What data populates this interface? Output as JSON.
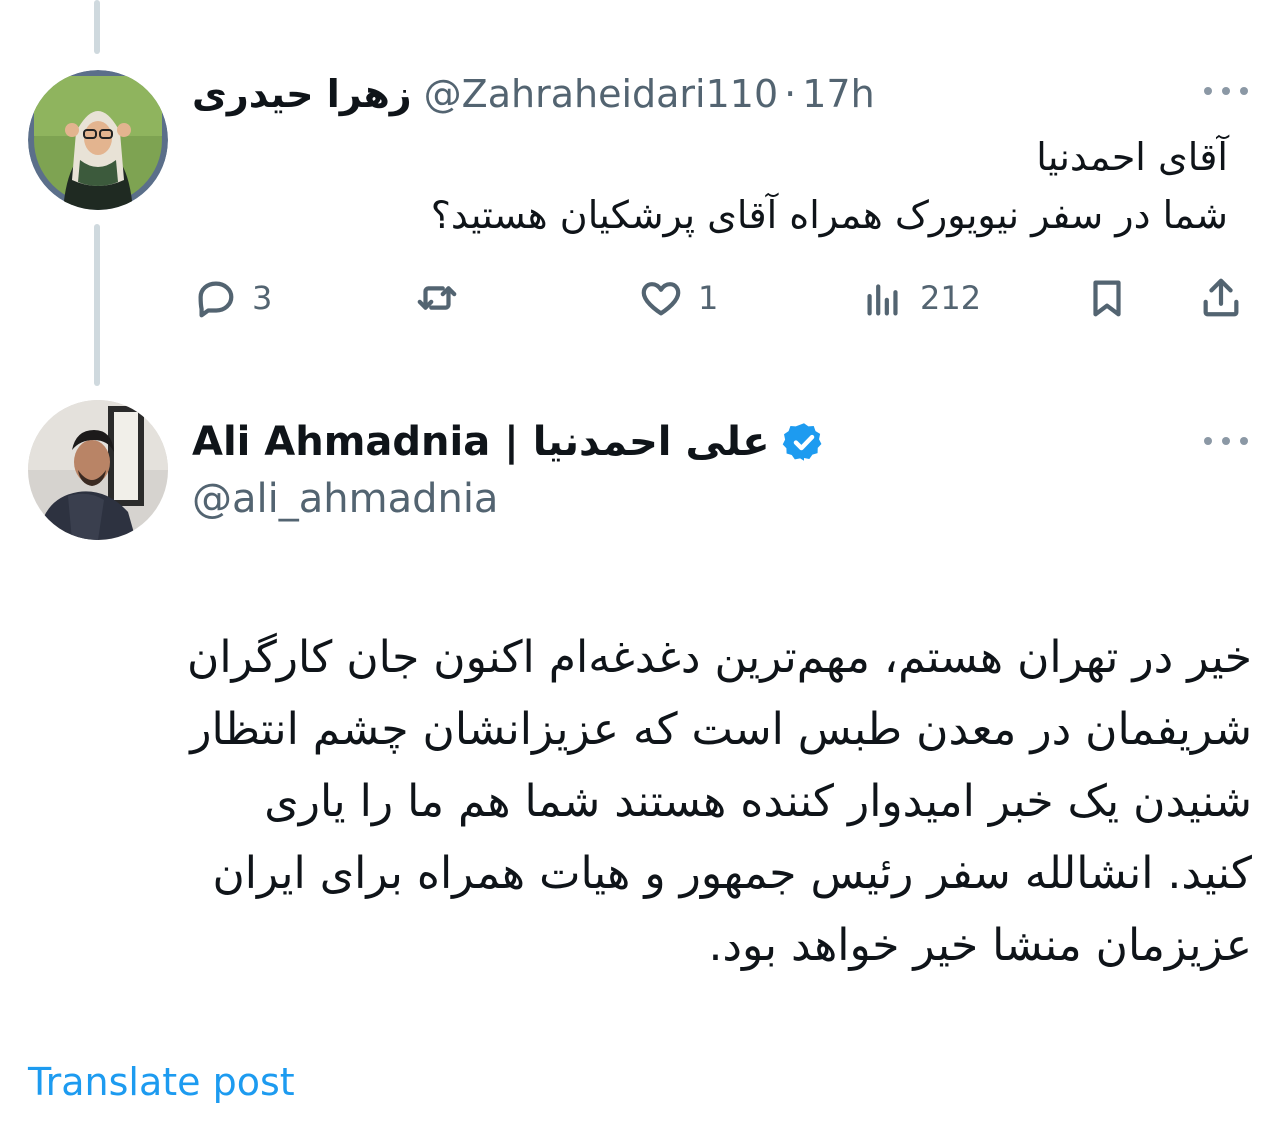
{
  "reply": {
    "author_name": "زهرا حیدری",
    "handle": "@Zahraheidari110",
    "separator": "·",
    "time": "17h",
    "text_lines": [
      "آقای احمدنیا",
      "شما در سفر نیویورک همراه آقای پرشکیان هستید؟"
    ],
    "actions": {
      "replies": "3",
      "reposts": "",
      "likes": "1",
      "views": "212"
    }
  },
  "post": {
    "author_name": "Ali Ahmadnia | علی احمدنیا",
    "handle": "@ali_ahmadnia",
    "verified": true,
    "text_lines": [
      "خیر در تهران هستم، مهم‌ترین دغدغه‌ام اکنون جان کارگران",
      "شریفمان در معدن طبس است که عزیزانشان چشم انتظار",
      "شنیدن یک خبر امیدوار کننده هستند شما هم ما را یاری",
      "کنید. انشالله سفر رئیس جمهور و هیات همراه برای ایران",
      "عزیزمان منشا خیر خواهد بود."
    ],
    "translate_label": "Translate post"
  },
  "colors": {
    "accent": "#1d9bf0",
    "secondary_text": "#536471",
    "thread_line": "#cfd9de"
  }
}
